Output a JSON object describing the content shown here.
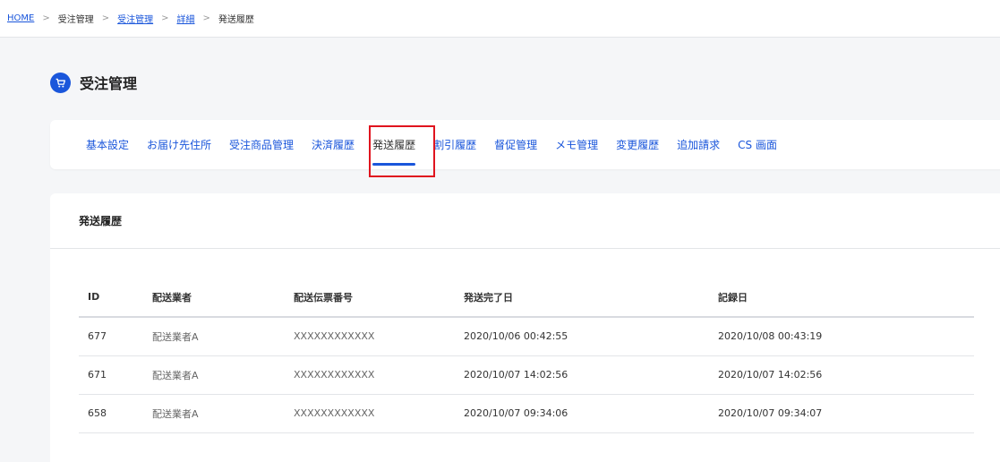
{
  "breadcrumb": {
    "items": [
      {
        "label": "HOME",
        "link": true
      },
      {
        "label": "受注管理",
        "link": false
      },
      {
        "label": "受注管理",
        "link": true
      },
      {
        "label": "詳細",
        "link": true
      },
      {
        "label": "発送履歴",
        "link": false
      }
    ],
    "separator": ">"
  },
  "page": {
    "title": "受注管理",
    "icon": "cart-icon"
  },
  "tabs": [
    {
      "label": "基本設定"
    },
    {
      "label": "お届け先住所"
    },
    {
      "label": "受注商品管理"
    },
    {
      "label": "決済履歴"
    },
    {
      "label": "発送履歴",
      "active": true
    },
    {
      "label": "割引履歴"
    },
    {
      "label": "督促管理"
    },
    {
      "label": "メモ管理"
    },
    {
      "label": "変更履歴"
    },
    {
      "label": "追加請求"
    },
    {
      "label": "CS 画面"
    }
  ],
  "shipping_history": {
    "title": "発送履歴",
    "columns": [
      "ID",
      "配送業者",
      "配送伝票番号",
      "発送完了日",
      "記録日"
    ],
    "rows": [
      [
        "677",
        "配送業者A",
        "XXXXXXXXXXXX",
        "2020/10/06 00:42:55",
        "2020/10/08 00:43:19"
      ],
      [
        "671",
        "配送業者A",
        "XXXXXXXXXXXX",
        "2020/10/07 14:02:56",
        "2020/10/07 14:02:56"
      ],
      [
        "658",
        "配送業者A",
        "XXXXXXXXXXXX",
        "2020/10/07 09:34:06",
        "2020/10/07 09:34:07"
      ]
    ]
  },
  "colors": {
    "accent": "#1a56db",
    "highlight": "#e0141e",
    "background": "#f5f6f8"
  }
}
